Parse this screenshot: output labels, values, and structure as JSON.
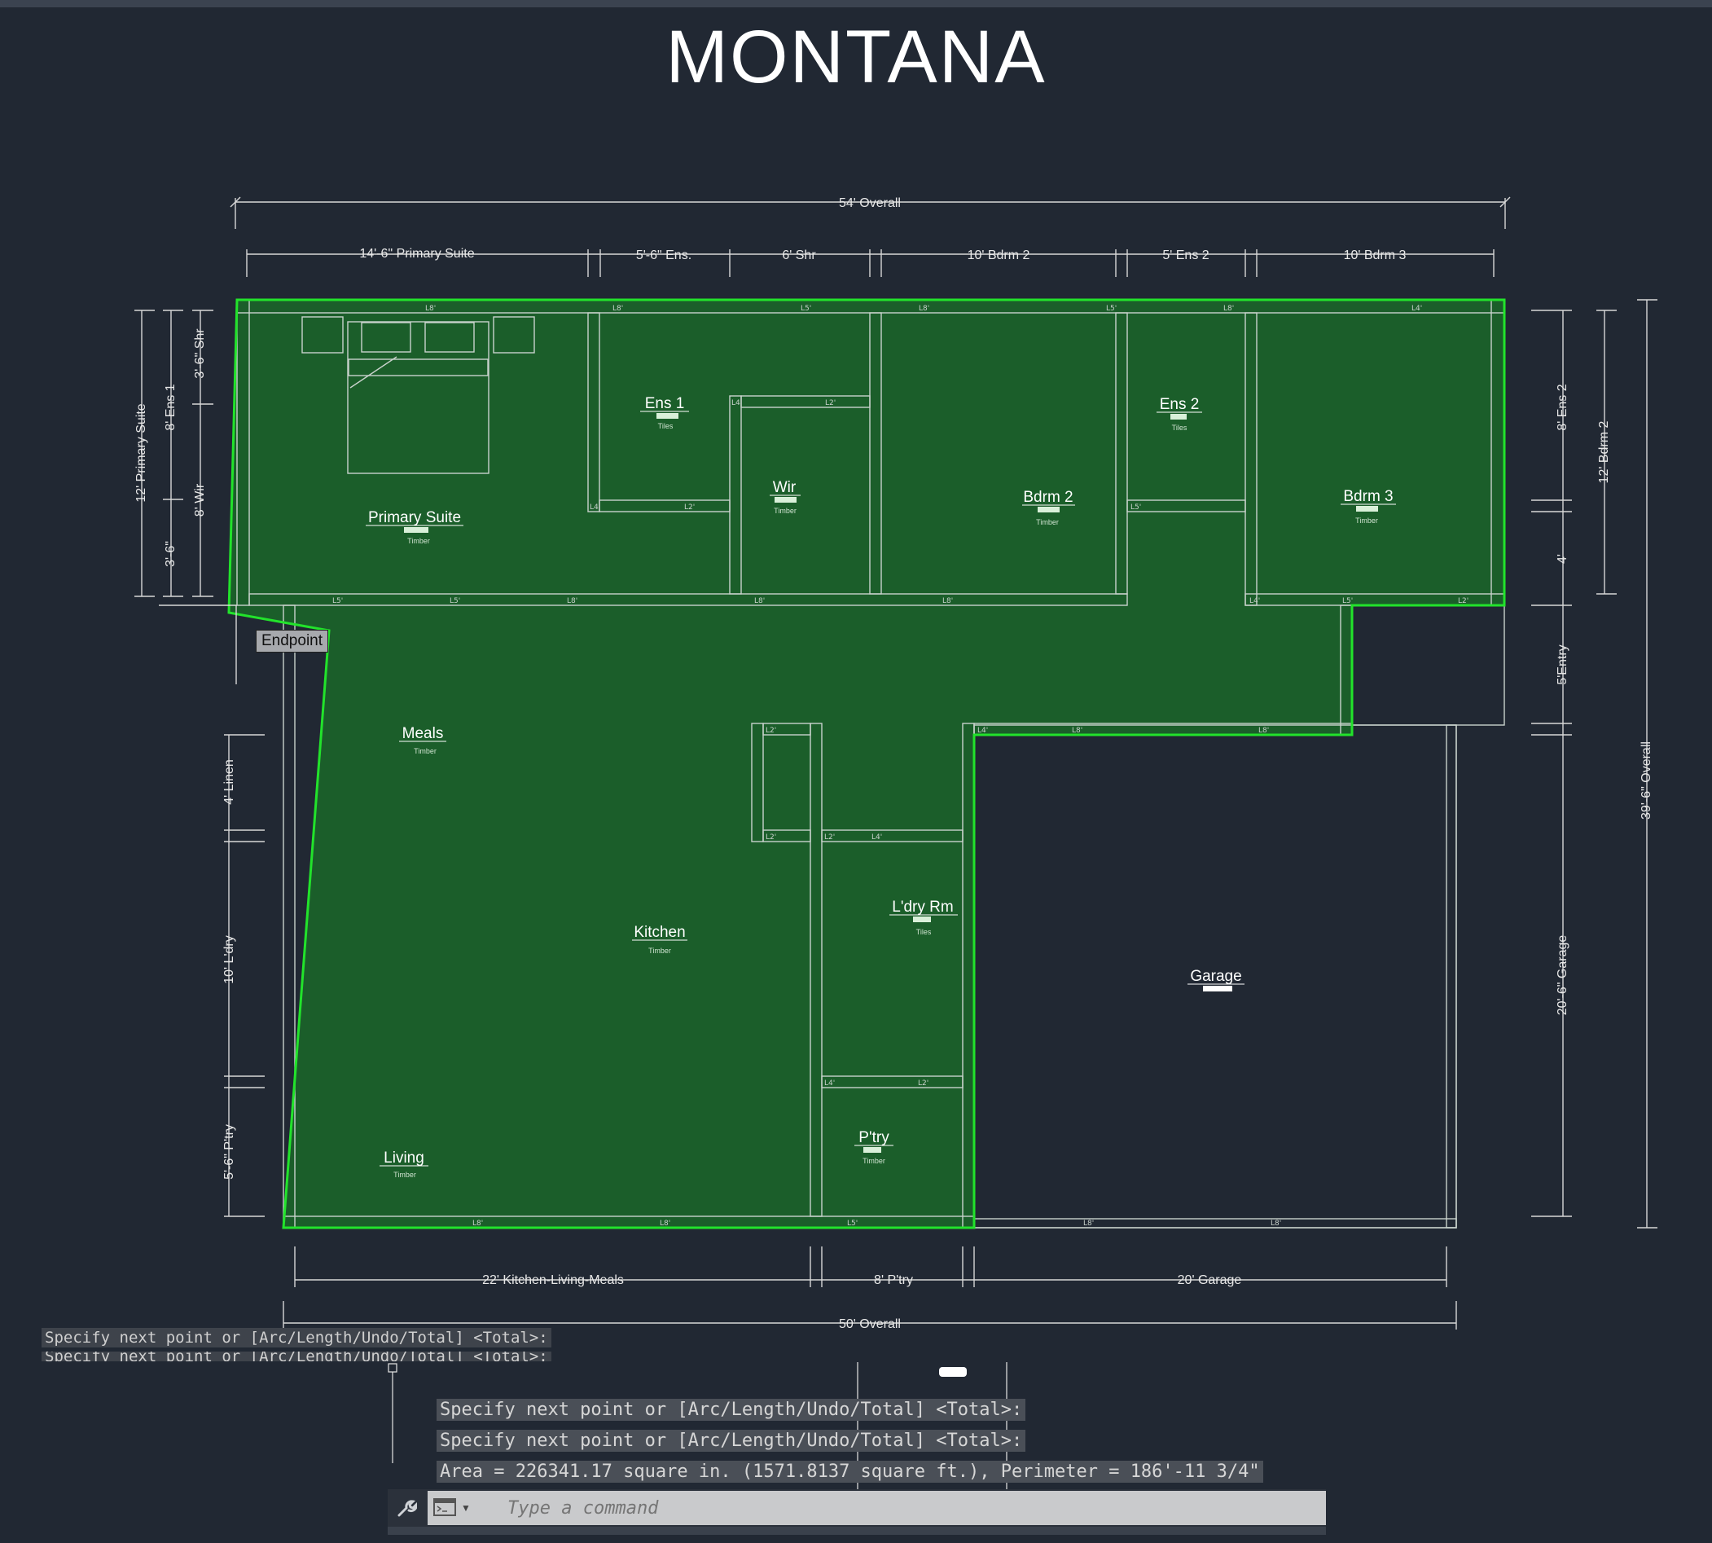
{
  "drawing_title": "MONTANA",
  "overall_top": "54' Overall",
  "overall_bottom": "50' Overall",
  "overall_right": "39'-6\" Overall",
  "top_dims": [
    "14'-6\" Primary Suite",
    "5'-6\" Ens.",
    "6' Shr",
    "10' Bdrm 2",
    "5' Ens 2",
    "10' Bdrm 3"
  ],
  "bottom_dims": [
    "22' Kitchen-Living-Meals",
    "8' P'try",
    "20' Garage"
  ],
  "left_dims": [
    "12' Primary Suite",
    "8' Ens 1",
    "3'-6\"",
    "3'-6\" Shr",
    "8' Wir",
    "4' Linen",
    "10' L'dry",
    "5'-6\" P'try"
  ],
  "right_dims": [
    "8' Ens 2",
    "12' Bdrm 2",
    "4'",
    "5'Entry",
    "20'-6\" Garage"
  ],
  "rooms": [
    {
      "name": "Primary Suite",
      "finish": "Timber"
    },
    {
      "name": "Ens 1",
      "finish": "Tiles"
    },
    {
      "name": "Wir",
      "finish": "Timber"
    },
    {
      "name": "Bdrm 2",
      "finish": "Timber"
    },
    {
      "name": "Ens 2",
      "finish": "Tiles"
    },
    {
      "name": "Bdrm 3",
      "finish": "Timber"
    },
    {
      "name": "Meals",
      "finish": "Timber"
    },
    {
      "name": "Kitchen",
      "finish": "Timber"
    },
    {
      "name": "L'dry Rm",
      "finish": "Tiles"
    },
    {
      "name": "P'try",
      "finish": "Timber"
    },
    {
      "name": "Living",
      "finish": "Timber"
    },
    {
      "name": "Garage",
      "finish": ""
    }
  ],
  "wall_tags": [
    "L8'",
    "L5'",
    "L4'",
    "L2'",
    "L8'",
    "L5'",
    "L8'",
    "L4'"
  ],
  "snap_tooltip": "Endpoint",
  "command_history": [
    "Specify next point or [Arc/Length/Undo/Total] <Total>:",
    "Specify next point or [Arc/Length/Undo/Total] <Total>:"
  ],
  "command_history_large": [
    "Specify next point or [Arc/Length/Undo/Total] <Total>:",
    "Specify next point or [Arc/Length/Undo/Total] <Total>:",
    "Area = 226341.17 square in. (1571.8137 square ft.), Perimeter = 186'-11 3/4\""
  ],
  "command_placeholder": "Type a command",
  "colors": {
    "background": "#212833",
    "area_fill": "#1b5e2a",
    "outline": "#22e32b",
    "wall": "#c9d2cc",
    "text": "#ffffff"
  }
}
